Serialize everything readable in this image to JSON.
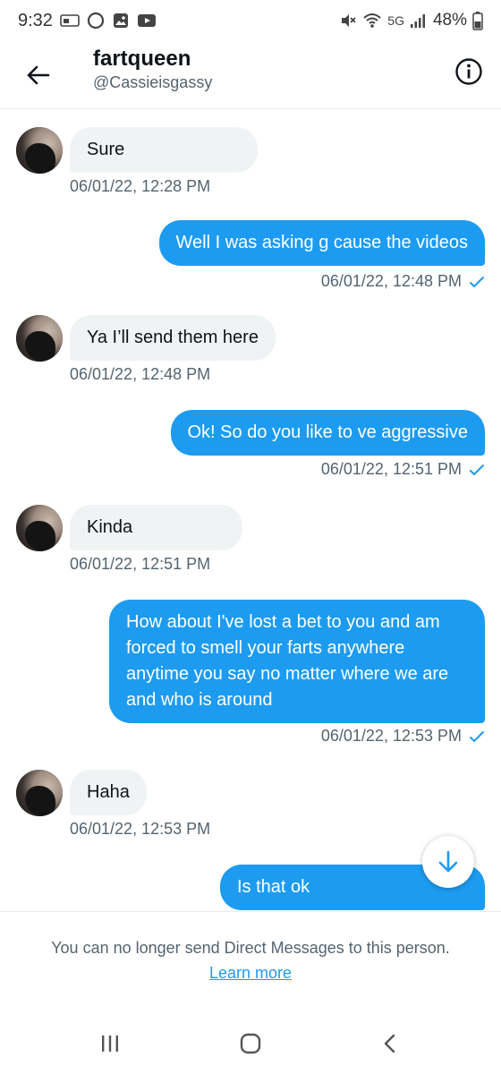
{
  "status_bar": {
    "time": "9:32",
    "left_icons": [
      "phone-card-icon",
      "circle-icon",
      "gallery-icon",
      "youtube-icon"
    ],
    "right_icons": [
      "mute-icon",
      "wifi-icon",
      "signal-icon",
      "battery-icon"
    ],
    "network": "5G",
    "battery": "48%"
  },
  "header": {
    "name": "fartqueen",
    "handle": "@Cassieisgassy"
  },
  "messages": [
    {
      "direction": "in",
      "text": "Sure",
      "timestamp": "06/01/22, 12:28 PM"
    },
    {
      "direction": "out",
      "text": "Well I was asking g cause the videos",
      "timestamp": "06/01/22, 12:48 PM",
      "seen": true
    },
    {
      "direction": "in",
      "text": "Ya I’ll send them here",
      "timestamp": "06/01/22, 12:48 PM"
    },
    {
      "direction": "out",
      "text": "Ok! So do you like to ve aggressive",
      "timestamp": "06/01/22, 12:51 PM",
      "seen": true
    },
    {
      "direction": "in",
      "text": "Kinda",
      "timestamp": "06/01/22, 12:51 PM"
    },
    {
      "direction": "out",
      "text": "How about I've lost a bet to you and am forced to smell your farts anywhere anytime you say no matter where we are and who is around",
      "timestamp": "06/01/22, 12:53 PM",
      "seen": true
    },
    {
      "direction": "in",
      "text": "Haha",
      "timestamp": "06/01/22, 12:53 PM"
    },
    {
      "direction": "out",
      "text": "Is that ok"
    }
  ],
  "footer": {
    "notice": "You can no longer send Direct Messages to this person.",
    "link": "Learn more"
  },
  "colors": {
    "accent": "#1d9bf0",
    "incoming_bubble": "#eff3f4",
    "secondary_text": "#536471"
  }
}
